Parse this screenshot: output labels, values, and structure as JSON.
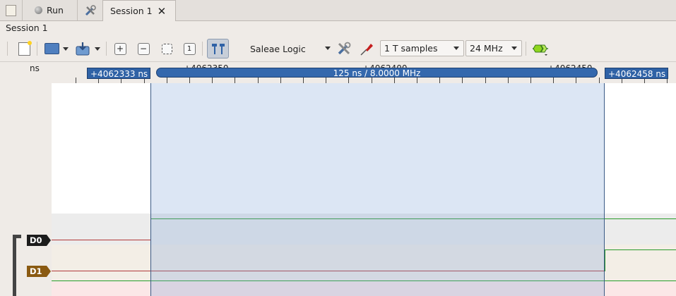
{
  "tabs": [
    {
      "label": "Run"
    },
    {
      "label": "Session 1"
    }
  ],
  "session": {
    "label": "Session 1"
  },
  "toolbar": {
    "device": "Saleae Logic",
    "samples": "1 T samples",
    "rate": "24 MHz"
  },
  "timeline": {
    "left_unit": "ns",
    "start_marker": "+4062333 ns",
    "end_marker": "+4062458 ns",
    "duration": "125 ns / 8.0000 MHz",
    "hidden_ticks": [
      "+4062350",
      "+4062400",
      "+4062450"
    ]
  },
  "channels": [
    {
      "label": "D0",
      "color": "#1c1c1c"
    },
    {
      "label": "D1",
      "color": "#8a5a12"
    }
  ],
  "colors": {
    "accent": "#2f62a6",
    "d0_trace": "#b23a3a",
    "d1_trace": "#2a9a2a"
  }
}
